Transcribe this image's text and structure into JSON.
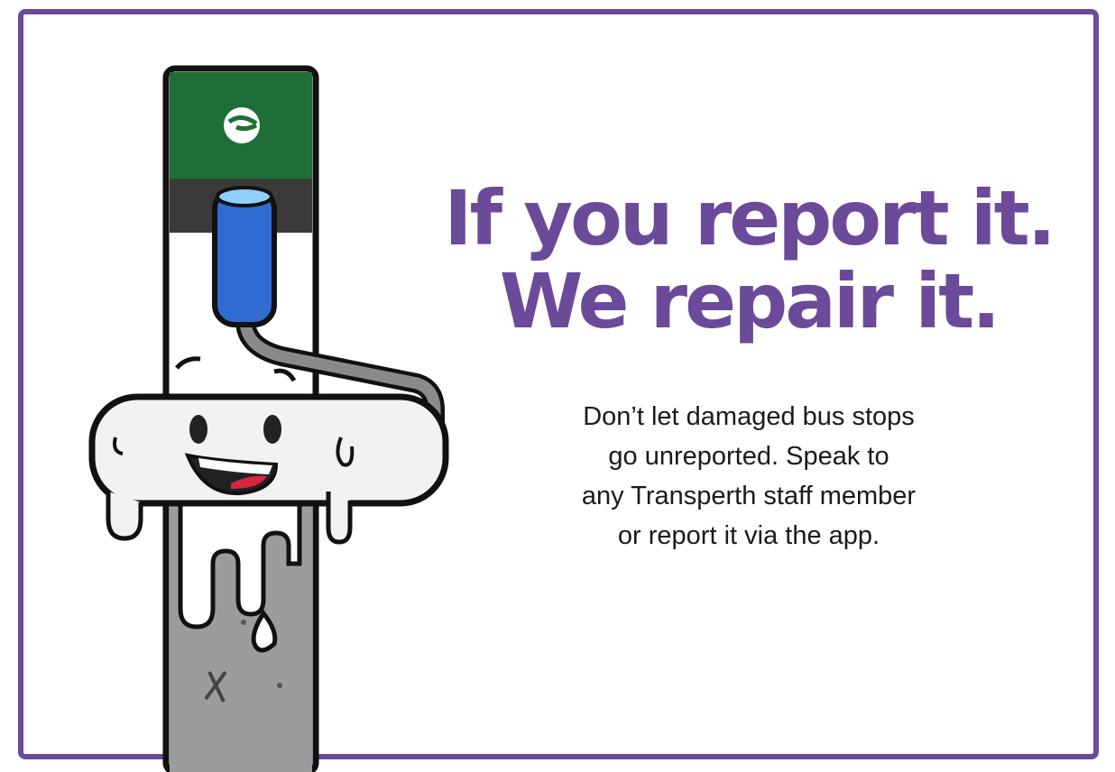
{
  "poster": {
    "headline_line1": "If you report it.",
    "headline_line2": "We repair it.",
    "body_lines": [
      "Don’t let damaged bus stops",
      "go unreported. Speak to",
      "any Transperth staff member",
      "or report it via the app."
    ]
  },
  "colors": {
    "accent": "#6b4a9a",
    "pole_green": "#1f6e35",
    "roller_blue": "#2f6bd0",
    "pole_grey": "#9a9a9a"
  },
  "icons": {
    "logo": "transperth-logo-icon",
    "illustration": "paint-roller-character"
  }
}
